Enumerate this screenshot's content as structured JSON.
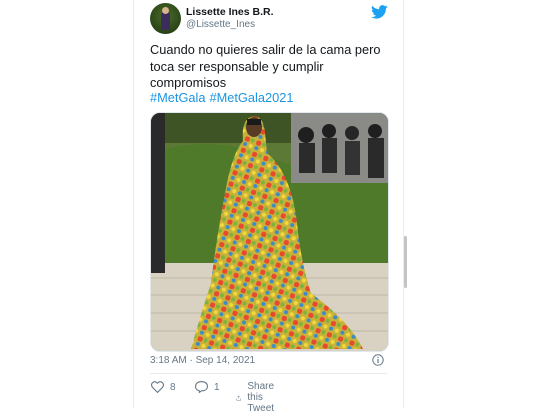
{
  "tweet": {
    "author_name": "Lissette Ines B.R.",
    "author_handle": "@Lissette_Ines",
    "text": "Cuando no quieres salir de la cama pero toca ser responsable y cumplir compromisos",
    "hashtags": [
      "#MetGala",
      "#MetGala2021"
    ],
    "timestamp": "3:18 AM · Sep 14, 2021",
    "likes": "8",
    "replies": "1",
    "share_label": "Share this Tweet"
  },
  "colors": {
    "link": "#1b95e0",
    "twitter_blue": "#1da1f2",
    "text_primary": "#14171a",
    "text_secondary": "#657786"
  },
  "icons": {
    "brand": "twitter-bird-icon",
    "info": "info-icon",
    "like": "heart-icon",
    "reply": "comment-icon",
    "share": "share-icon"
  }
}
